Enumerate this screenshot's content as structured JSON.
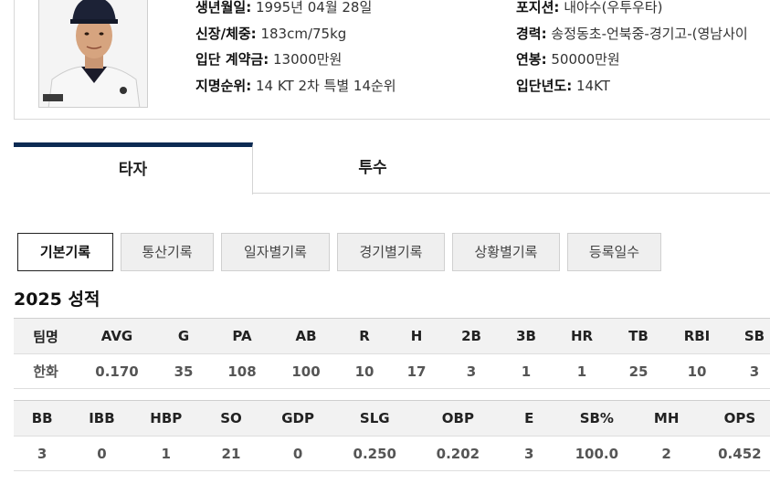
{
  "profile": {
    "left": [
      {
        "label": "생년월일:",
        "value": "1995년 04월 28일"
      },
      {
        "label": "신장/체중:",
        "value": "183cm/75kg"
      },
      {
        "label": "입단 계약금:",
        "value": "13000만원"
      },
      {
        "label": "지명순위:",
        "value": "14 KT 2차 특별 14순위"
      }
    ],
    "right": [
      {
        "label": "포지션:",
        "value": "내야수(우투우타)"
      },
      {
        "label": "경력:",
        "value": "송정동초-언북중-경기고-(영남사이"
      },
      {
        "label": "연봉:",
        "value": "50000만원"
      },
      {
        "label": "입단년도:",
        "value": "14KT"
      }
    ]
  },
  "main_tabs": [
    {
      "label": "타자"
    },
    {
      "label": "투수"
    }
  ],
  "sub_tabs": [
    {
      "label": "기본기록"
    },
    {
      "label": "통산기록"
    },
    {
      "label": "일자별기록"
    },
    {
      "label": "경기별기록"
    },
    {
      "label": "상황별기록"
    },
    {
      "label": "등록일수"
    }
  ],
  "season_title": "2025 성적",
  "table1": {
    "headers": [
      "팀명",
      "AVG",
      "G",
      "PA",
      "AB",
      "R",
      "H",
      "2B",
      "3B",
      "HR",
      "TB",
      "RBI",
      "SB"
    ],
    "row": [
      "한화",
      "0.170",
      "35",
      "108",
      "100",
      "10",
      "17",
      "3",
      "1",
      "1",
      "25",
      "10",
      "3"
    ]
  },
  "table2": {
    "headers": [
      "BB",
      "IBB",
      "HBP",
      "SO",
      "GDP",
      "SLG",
      "OBP",
      "E",
      "SB%",
      "MH",
      "OPS"
    ],
    "row": [
      "3",
      "0",
      "1",
      "21",
      "0",
      "0.250",
      "0.202",
      "3",
      "100.0",
      "2",
      "0.452"
    ]
  },
  "colors": {
    "accent": "#0c2a53",
    "header_bg": "#f2f2f2",
    "subtab_bg": "#efefef"
  }
}
